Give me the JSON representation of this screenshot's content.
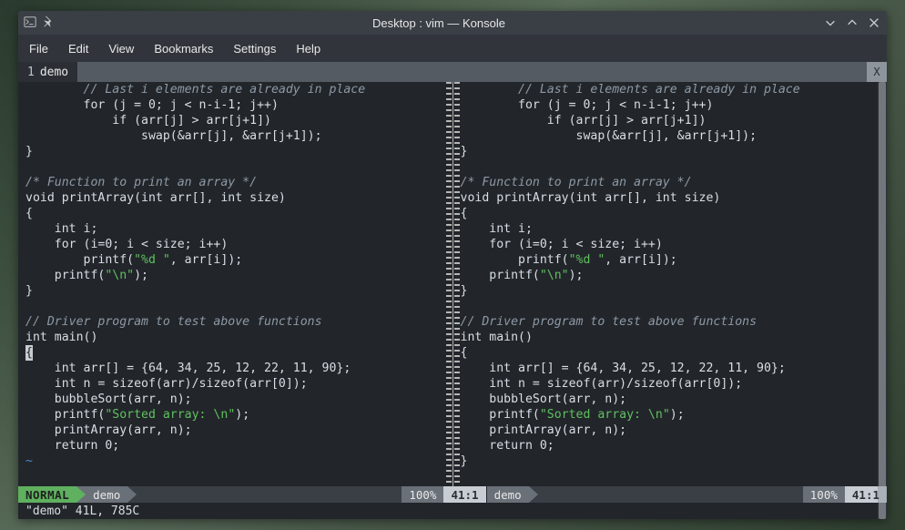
{
  "window": {
    "title": "Desktop : vim — Konsole"
  },
  "menubar": [
    "File",
    "Edit",
    "View",
    "Bookmarks",
    "Settings",
    "Help"
  ],
  "tab": {
    "index": "1",
    "name": "demo",
    "close": "X"
  },
  "code": {
    "lines": [
      {
        "indent": "        ",
        "type": "comment",
        "text": "// Last i elements are already in place"
      },
      {
        "indent": "        ",
        "type": "plain",
        "text": "for (j = 0; j < n-i-1; j++)"
      },
      {
        "indent": "            ",
        "type": "plain",
        "text": "if (arr[j] > arr[j+1])"
      },
      {
        "indent": "                ",
        "type": "plain",
        "text": "swap(&arr[j], &arr[j+1]);"
      },
      {
        "indent": "",
        "type": "plain",
        "text": "}"
      },
      {
        "indent": "",
        "type": "blank",
        "text": ""
      },
      {
        "indent": "",
        "type": "comment",
        "text": "/* Function to print an array */"
      },
      {
        "indent": "",
        "type": "plain",
        "text": "void printArray(int arr[], int size)"
      },
      {
        "indent": "",
        "type": "plain",
        "text": "{"
      },
      {
        "indent": "    ",
        "type": "plain",
        "text": "int i;"
      },
      {
        "indent": "    ",
        "type": "plain",
        "text": "for (i=0; i < size; i++)"
      },
      {
        "indent": "        ",
        "type": "printf",
        "pre": "printf(",
        "str": "\"%d \"",
        "post": ", arr[i]);"
      },
      {
        "indent": "    ",
        "type": "printf",
        "pre": "printf(",
        "str": "\"\\n\"",
        "post": ");"
      },
      {
        "indent": "",
        "type": "plain",
        "text": "}"
      },
      {
        "indent": "",
        "type": "blank",
        "text": ""
      },
      {
        "indent": "",
        "type": "comment",
        "text": "// Driver program to test above functions"
      },
      {
        "indent": "",
        "type": "plain",
        "text": "int main()"
      },
      {
        "indent": "",
        "type": "cursor",
        "text": "{"
      },
      {
        "indent": "    ",
        "type": "plain",
        "text": "int arr[] = {64, 34, 25, 12, 22, 11, 90};"
      },
      {
        "indent": "    ",
        "type": "plain",
        "text": "int n = sizeof(arr)/sizeof(arr[0]);"
      },
      {
        "indent": "    ",
        "type": "plain",
        "text": "bubbleSort(arr, n);"
      },
      {
        "indent": "    ",
        "type": "printf",
        "pre": "printf(",
        "str": "\"Sorted array: \\n\"",
        "post": ");"
      },
      {
        "indent": "    ",
        "type": "plain",
        "text": "printArray(arr, n);"
      },
      {
        "indent": "    ",
        "type": "plain",
        "text": "return 0;"
      }
    ],
    "closing_left_tilde": "~",
    "closing_right": "}"
  },
  "status": {
    "mode": "NORMAL",
    "filename": "demo",
    "percent": "100%",
    "position": "41:1"
  },
  "bottom_message": "\"demo\" 41L, 785C"
}
